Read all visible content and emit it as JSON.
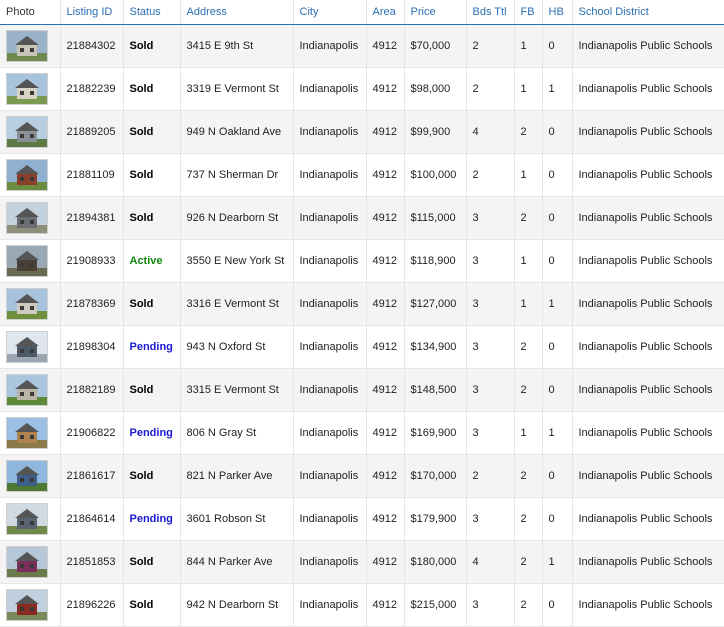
{
  "columns": [
    "Photo",
    "Listing ID",
    "Status",
    "Address",
    "City",
    "Area",
    "Price",
    "Bds Ttl",
    "FB",
    "HB",
    "School District"
  ],
  "status_colors": {
    "Sold": "#000000",
    "Active": "#118811",
    "Pending": "#1a1ad6"
  },
  "rows": [
    {
      "photo": "house-photo",
      "id": "21884302",
      "status": "Sold",
      "address": "3415 E 9th St",
      "city": "Indianapolis",
      "area": "4912",
      "price": "$70,000",
      "beds": "2",
      "fb": "1",
      "hb": "0",
      "district": "Indianapolis Public Schools",
      "photo_colors": [
        "#9bb3c8",
        "#6e8a4e",
        "#c9c4b8"
      ]
    },
    {
      "photo": "house-photo",
      "id": "21882239",
      "status": "Sold",
      "address": "3319 E Vermont St",
      "city": "Indianapolis",
      "area": "4912",
      "price": "$98,000",
      "beds": "2",
      "fb": "1",
      "hb": "1",
      "district": "Indianapolis Public Schools",
      "photo_colors": [
        "#a8c4dc",
        "#7a9a52",
        "#d8d2c4"
      ]
    },
    {
      "photo": "house-photo",
      "id": "21889205",
      "status": "Sold",
      "address": "949 N Oakland Ave",
      "city": "Indianapolis",
      "area": "4912",
      "price": "$99,900",
      "beds": "4",
      "fb": "2",
      "hb": "0",
      "district": "Indianapolis Public Schools",
      "photo_colors": [
        "#b8cde0",
        "#5d7a44",
        "#8a8f98"
      ]
    },
    {
      "photo": "house-photo",
      "id": "21881109",
      "status": "Sold",
      "address": "737 N Sherman Dr",
      "city": "Indianapolis",
      "area": "4912",
      "price": "$100,000",
      "beds": "2",
      "fb": "1",
      "hb": "0",
      "district": "Indianapolis Public Schools",
      "photo_colors": [
        "#8fb0d0",
        "#6b8c3e",
        "#8a3f2a"
      ]
    },
    {
      "photo": "house-photo",
      "id": "21894381",
      "status": "Sold",
      "address": "926 N Dearborn St",
      "city": "Indianapolis",
      "area": "4912",
      "price": "$115,000",
      "beds": "3",
      "fb": "2",
      "hb": "0",
      "district": "Indianapolis Public Schools",
      "photo_colors": [
        "#c4d2de",
        "#8c8f7a",
        "#6b6e72"
      ]
    },
    {
      "photo": "house-photo",
      "id": "21908933",
      "status": "Active",
      "address": "3550 E New York St",
      "city": "Indianapolis",
      "area": "4912",
      "price": "$118,900",
      "beds": "3",
      "fb": "1",
      "hb": "0",
      "district": "Indianapolis Public Schools",
      "photo_colors": [
        "#9aa8b4",
        "#6a6a52",
        "#4a4036"
      ]
    },
    {
      "photo": "house-photo",
      "id": "21878369",
      "status": "Sold",
      "address": "3316 E Vermont St",
      "city": "Indianapolis",
      "area": "4912",
      "price": "$127,000",
      "beds": "3",
      "fb": "1",
      "hb": "1",
      "district": "Indianapolis Public Schools",
      "photo_colors": [
        "#a6c2dc",
        "#6f8f3c",
        "#cfcac0"
      ]
    },
    {
      "photo": "house-photo",
      "id": "21898304",
      "status": "Pending",
      "address": "943 N Oxford St",
      "city": "Indianapolis",
      "area": "4912",
      "price": "$134,900",
      "beds": "3",
      "fb": "2",
      "hb": "0",
      "district": "Indianapolis Public Schools",
      "photo_colors": [
        "#dfe6ee",
        "#9aa7b2",
        "#4d5a66"
      ]
    },
    {
      "photo": "house-photo",
      "id": "21882189",
      "status": "Sold",
      "address": "3315 E Vermont St",
      "city": "Indianapolis",
      "area": "4912",
      "price": "$148,500",
      "beds": "3",
      "fb": "2",
      "hb": "0",
      "district": "Indianapolis Public Schools",
      "photo_colors": [
        "#a9c6de",
        "#5f8a3a",
        "#b9b4a6"
      ]
    },
    {
      "photo": "house-photo",
      "id": "21906822",
      "status": "Pending",
      "address": "806 N Gray St",
      "city": "Indianapolis",
      "area": "4912",
      "price": "$169,900",
      "beds": "3",
      "fb": "1",
      "hb": "1",
      "district": "Indianapolis Public Schools",
      "photo_colors": [
        "#9cc0e4",
        "#8a7a4a",
        "#b0824e"
      ]
    },
    {
      "photo": "house-photo",
      "id": "21861617",
      "status": "Sold",
      "address": "821 N Parker Ave",
      "city": "Indianapolis",
      "area": "4912",
      "price": "$170,000",
      "beds": "2",
      "fb": "2",
      "hb": "0",
      "district": "Indianapolis Public Schools",
      "photo_colors": [
        "#8fb6dc",
        "#4f7a34",
        "#3e5f88"
      ]
    },
    {
      "photo": "house-photo",
      "id": "21864614",
      "status": "Pending",
      "address": "3601 Robson St",
      "city": "Indianapolis",
      "area": "4912",
      "price": "$179,900",
      "beds": "3",
      "fb": "2",
      "hb": "0",
      "district": "Indianapolis Public Schools",
      "photo_colors": [
        "#d0dae2",
        "#6f8a4a",
        "#5a6470"
      ]
    },
    {
      "photo": "house-photo",
      "id": "21851853",
      "status": "Sold",
      "address": "844 N Parker Ave",
      "city": "Indianapolis",
      "area": "4912",
      "price": "$180,000",
      "beds": "4",
      "fb": "2",
      "hb": "1",
      "district": "Indianapolis Public Schools",
      "photo_colors": [
        "#b6c8d8",
        "#6a7a4a",
        "#7a2f5a"
      ]
    },
    {
      "photo": "house-photo",
      "id": "21896226",
      "status": "Sold",
      "address": "942 N Dearborn St",
      "city": "Indianapolis",
      "area": "4912",
      "price": "$215,000",
      "beds": "3",
      "fb": "2",
      "hb": "0",
      "district": "Indianapolis Public Schools",
      "photo_colors": [
        "#c0d0de",
        "#7a8a5a",
        "#8a2a22"
      ]
    }
  ]
}
